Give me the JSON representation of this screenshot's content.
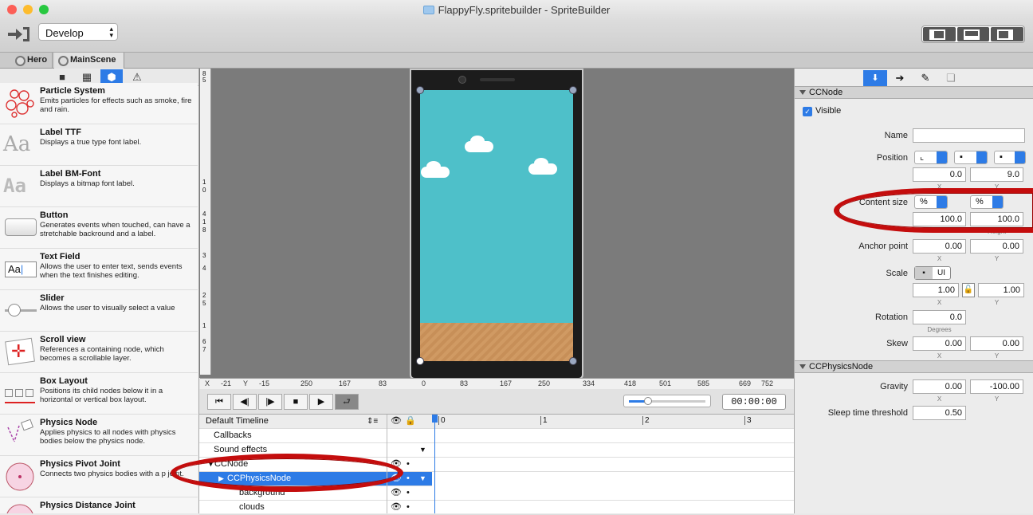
{
  "window": {
    "title": "FlappyFly.spritebuilder - SpriteBuilder"
  },
  "toolbar": {
    "scheme": "Develop",
    "icons": [
      "publish-icon",
      "view-left-panel",
      "view-bottom-panel",
      "view-right-panel"
    ]
  },
  "doc_tabs": [
    {
      "label": "Hero"
    },
    {
      "label": "MainScene"
    }
  ],
  "library": {
    "tabs": [
      "folder-icon",
      "grid-icon",
      "cube-icon",
      "warning-icon"
    ],
    "items": [
      {
        "name": "Particle System",
        "desc": "Emits particles for effects such as smoke, fire and rain."
      },
      {
        "name": "Label TTF",
        "desc": "Displays a true type font label."
      },
      {
        "name": "Label BM-Font",
        "desc": "Displays a bitmap font label."
      },
      {
        "name": "Button",
        "desc": "Generates events when touched, can have a stretchable backround and a label."
      },
      {
        "name": "Text Field",
        "desc": "Allows the user to enter text, sends events when the text finishes editing."
      },
      {
        "name": "Slider",
        "desc": "Allows the user to visually select a value"
      },
      {
        "name": "Scroll view",
        "desc": "References a containing node, which becomes a scrollable layer."
      },
      {
        "name": "Box Layout",
        "desc": "Positions its child nodes below it in a horizontal or vertical box layout."
      },
      {
        "name": "Physics Node",
        "desc": "Applies physics to all nodes with physics bodies below the physics node."
      },
      {
        "name": "Physics Pivot Joint",
        "desc": "Connects two physics bodies with a p joint."
      },
      {
        "name": "Physics Distance Joint",
        "desc": ""
      }
    ]
  },
  "rulers": {
    "bottom_ticks": [
      "X",
      "-21",
      "Y",
      "-15",
      "250",
      "167",
      "83",
      "0",
      "83",
      "167",
      "250",
      "334",
      "418",
      "501",
      "585",
      "669",
      "752"
    ],
    "left_ticks": [
      "8",
      "5",
      "1",
      "0",
      "4",
      "1",
      "8",
      "3",
      "4",
      "2",
      "5",
      "1",
      "6",
      "7",
      "8",
      "0"
    ]
  },
  "timeline": {
    "controls": [
      "skip-back-icon",
      "step-back-icon",
      "step-forward-icon",
      "stop-icon",
      "play-icon",
      "loop-icon"
    ],
    "timecode": "00:00:00",
    "zoom": 0.25,
    "header": "Default Timeline",
    "marks": [
      "0",
      "1",
      "2",
      "3"
    ],
    "rows": [
      {
        "label": "Callbacks",
        "indent": 0
      },
      {
        "label": "Sound effects",
        "indent": 0
      },
      {
        "label": "CCNode",
        "indent": 0
      },
      {
        "label": "CCPhysicsNode",
        "indent": 1,
        "selected": true
      },
      {
        "label": "background",
        "indent": 2
      },
      {
        "label": "clouds",
        "indent": 2
      }
    ]
  },
  "inspector": {
    "tabs": [
      "properties-icon",
      "code-connections-icon",
      "physics-icon",
      "templates-icon"
    ],
    "ccnode": {
      "header": "CCNode",
      "visible_label": "Visible",
      "visible": true,
      "name_label": "Name",
      "name_value": "",
      "position_label": "Position",
      "position_x": "0.0",
      "position_y": "9.0",
      "content_size_label": "Content size",
      "content_unit_w": "%",
      "content_unit_h": "%",
      "content_w": "100.0",
      "content_h": "100.0",
      "anchor_label": "Anchor point",
      "anchor_x": "0.00",
      "anchor_y": "0.00",
      "scale_label": "Scale",
      "scale_ui": "UI",
      "scale_x": "1.00",
      "scale_y": "1.00",
      "rotation_label": "Rotation",
      "rotation": "0.0",
      "degrees": "Degrees",
      "skew_label": "Skew",
      "skew_x": "0.00",
      "skew_y": "0.00",
      "x": "X",
      "y": "Y",
      "height": "Height"
    },
    "physics": {
      "header": "CCPhysicsNode",
      "gravity_label": "Gravity",
      "gravity_x": "0.00",
      "gravity_y": "-100.00",
      "sleep_label": "Sleep time threshold",
      "sleep": "0.50"
    }
  },
  "colors": {
    "accent": "#2d7be6",
    "highlight": "#c40d0d",
    "sky": "#4ec0c9",
    "ground": "#d09a63"
  }
}
